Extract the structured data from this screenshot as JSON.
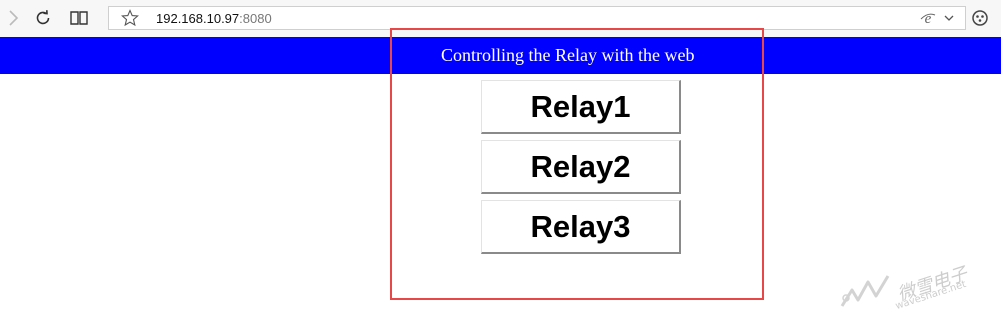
{
  "browser": {
    "url_host": "192.168.10.97",
    "url_port": ":8080",
    "icons": [
      "forward-icon",
      "refresh-icon",
      "reading-view-icon",
      "favorite-star-icon",
      "ie-mode-icon",
      "chevron-down-icon",
      "extension-icon"
    ]
  },
  "page": {
    "banner_title": "Controlling the Relay with the web",
    "banner_color": "#0000ff",
    "buttons": [
      {
        "label": "Relay1"
      },
      {
        "label": "Relay2"
      },
      {
        "label": "Relay3"
      }
    ]
  },
  "annotation": {
    "highlight_color": "#e74747"
  },
  "watermark": {
    "text_cn": "微雪电子",
    "text_en": "waveshare.net"
  }
}
